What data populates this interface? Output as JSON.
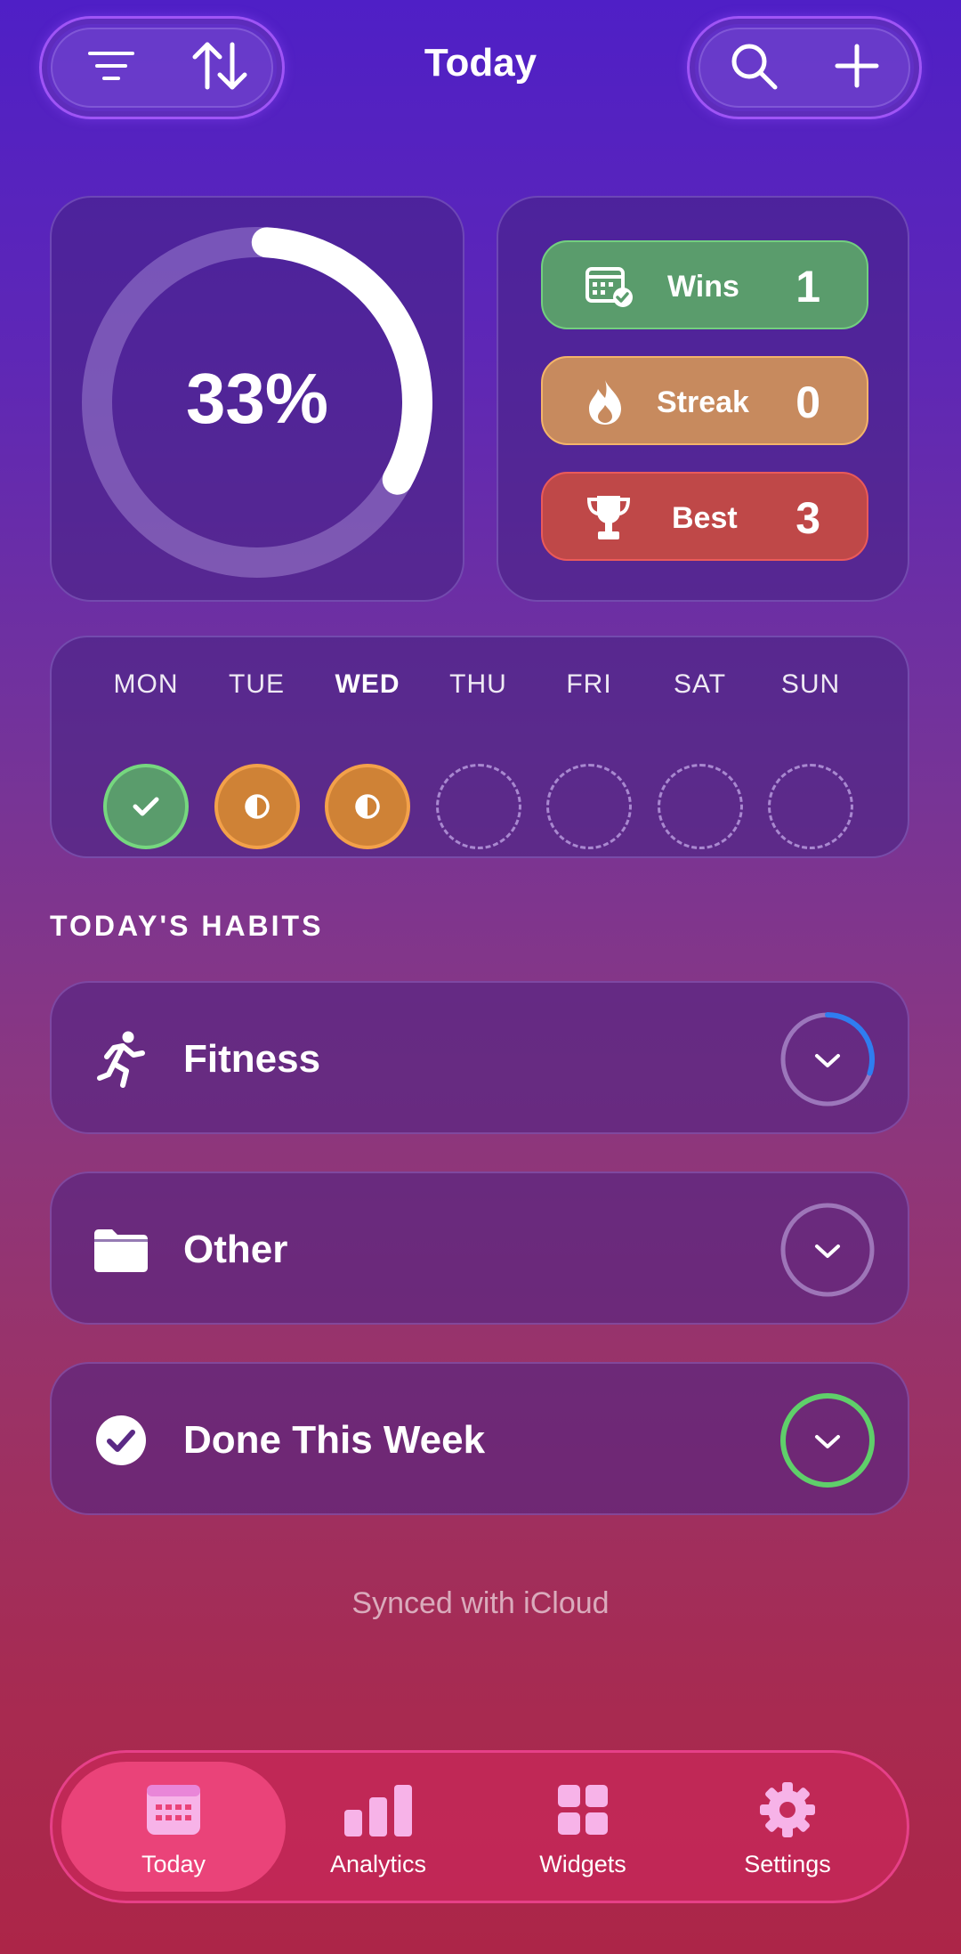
{
  "header": {
    "title": "Today",
    "left_icons": [
      "filter-icon",
      "sort-icon"
    ],
    "right_icons": [
      "search-icon",
      "plus-icon"
    ]
  },
  "progress": {
    "percent_label": "33%",
    "value": 0.33
  },
  "stats": [
    {
      "label": "Wins",
      "value": "1",
      "icon": "calendar-check-icon",
      "color": "#5a9c6c"
    },
    {
      "label": "Streak",
      "value": "0",
      "icon": "flame-icon",
      "color": "#c78a5e"
    },
    {
      "label": "Best",
      "value": "3",
      "icon": "trophy-icon",
      "color": "#bf4848"
    }
  ],
  "week": {
    "days": [
      {
        "name": "MON",
        "status": "done"
      },
      {
        "name": "TUE",
        "status": "partial"
      },
      {
        "name": "WED",
        "status": "partial",
        "current": true
      },
      {
        "name": "THU",
        "status": "empty"
      },
      {
        "name": "FRI",
        "status": "empty"
      },
      {
        "name": "SAT",
        "status": "empty"
      },
      {
        "name": "SUN",
        "status": "empty"
      }
    ]
  },
  "habits_section": {
    "title": "TODAY'S HABITS",
    "items": [
      {
        "label": "Fitness",
        "icon": "running-icon",
        "progress": 0.3,
        "ring_color": "#2f7df0"
      },
      {
        "label": "Other",
        "icon": "folder-icon",
        "progress": 0,
        "ring_color": "#a98fcf"
      },
      {
        "label": "Done This Week",
        "icon": "checkmark-circle-icon",
        "progress": 1,
        "ring_color": "#5fcf6a"
      }
    ]
  },
  "footer": {
    "synced": "Synced with iCloud"
  },
  "tabbar": {
    "tabs": [
      {
        "label": "Today",
        "icon": "calendar-icon",
        "active": true
      },
      {
        "label": "Analytics",
        "icon": "bar-chart-icon",
        "active": false
      },
      {
        "label": "Widgets",
        "icon": "grid-icon",
        "active": false
      },
      {
        "label": "Settings",
        "icon": "gear-icon",
        "active": false
      }
    ]
  },
  "colors": {
    "done": "#5a9c6c",
    "partial": "#cf8236",
    "accent_tab": "#ea4379"
  }
}
